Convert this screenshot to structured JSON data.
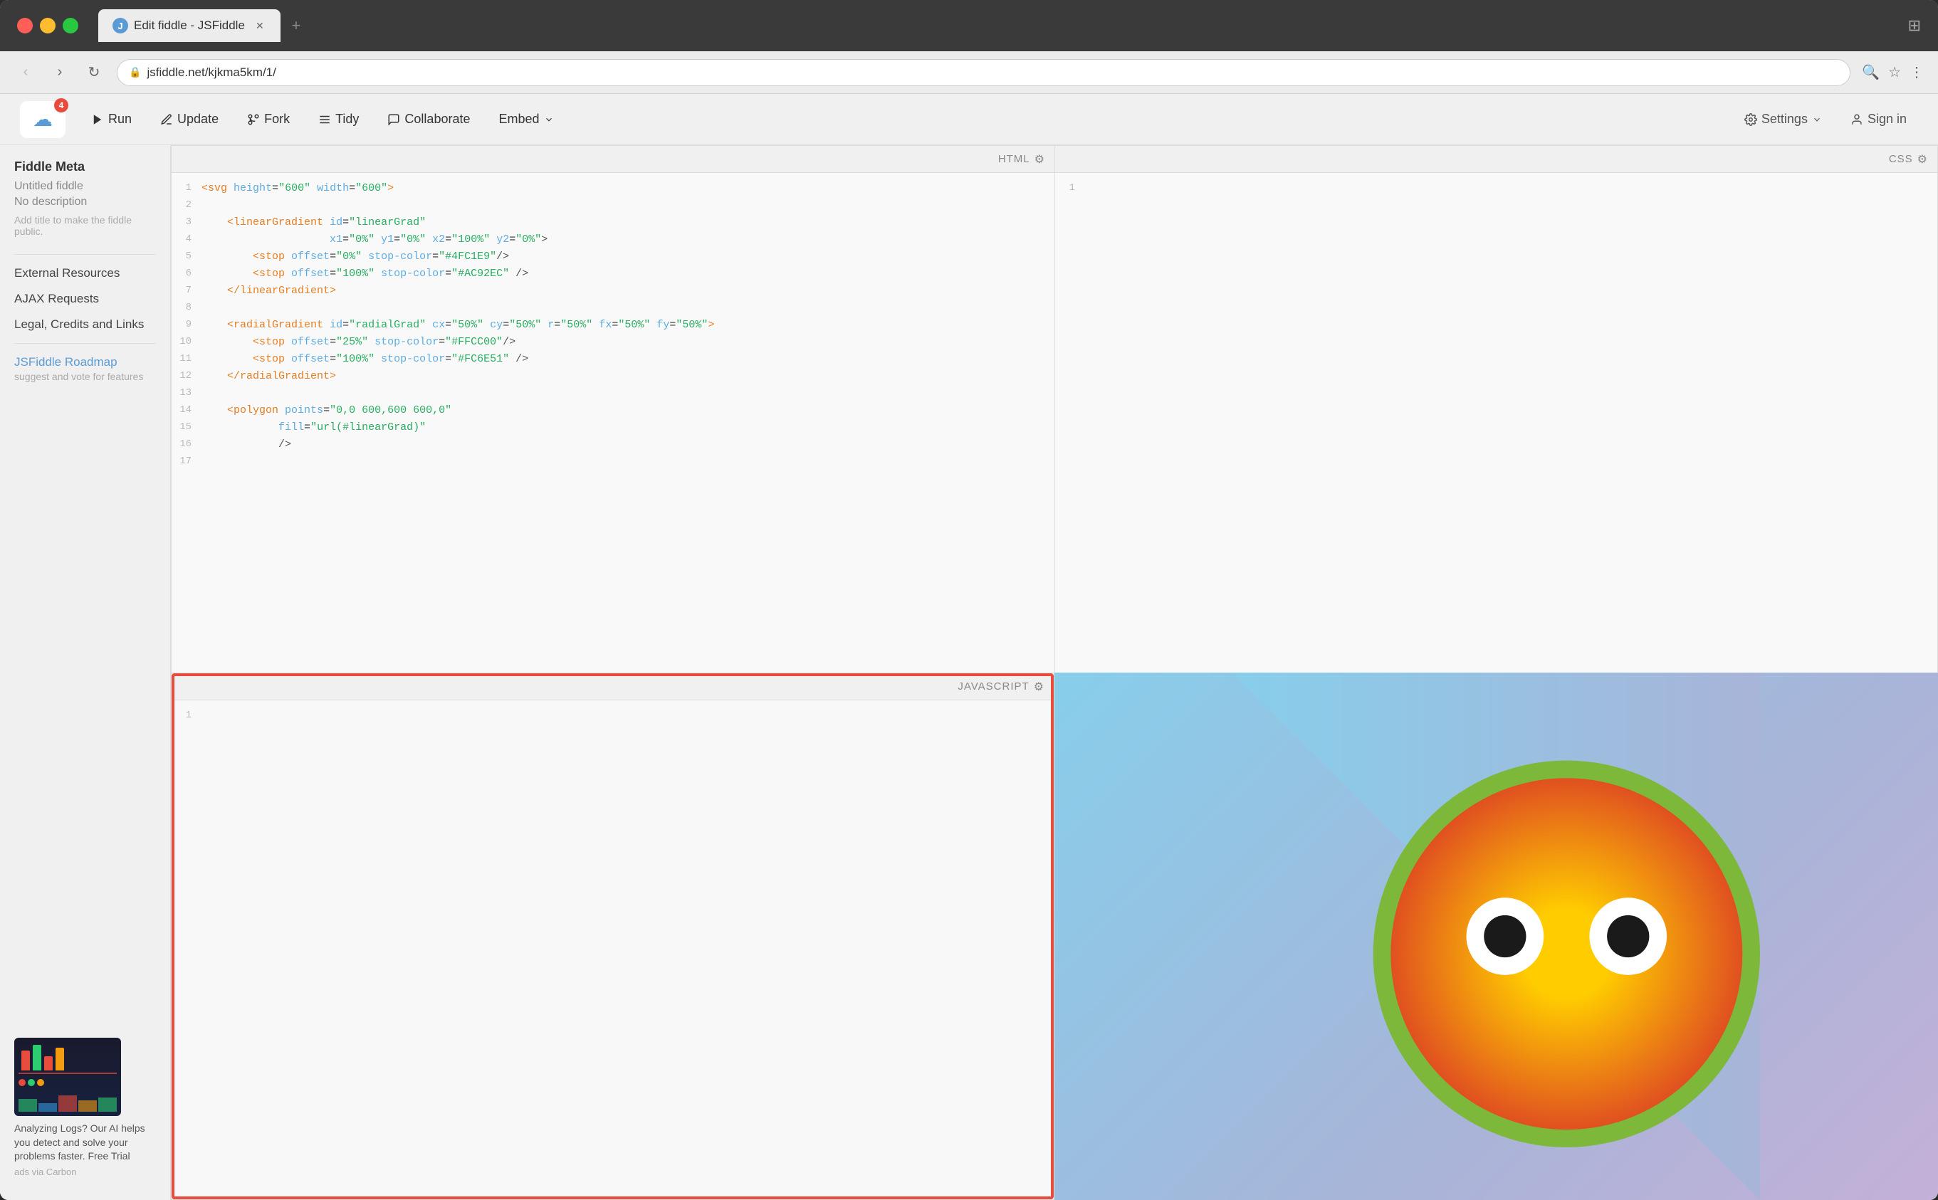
{
  "browser": {
    "traffic_lights": [
      "red",
      "yellow",
      "green"
    ],
    "tab": {
      "title": "Edit fiddle - JSFiddle",
      "favicon_letter": "J"
    },
    "address": "jsfiddle.net/kjkma5km/1/",
    "nav_back": "‹",
    "nav_forward": "›",
    "nav_reload": "↻"
  },
  "toolbar": {
    "logo_badge": "4",
    "run_label": "Run",
    "update_label": "Update",
    "fork_label": "Fork",
    "tidy_label": "Tidy",
    "collaborate_label": "Collaborate",
    "embed_label": "Embed",
    "settings_label": "Settings",
    "signin_label": "Sign in"
  },
  "sidebar": {
    "meta_title": "Fiddle Meta",
    "fiddle_name": "Untitled fiddle",
    "fiddle_desc": "No description",
    "hint": "Add title to make the fiddle public.",
    "external_resources_label": "External Resources",
    "ajax_requests_label": "AJAX Requests",
    "legal_label": "Legal, Credits and Links",
    "roadmap_title": "JSFiddle Roadmap",
    "roadmap_desc": "suggest and vote for features",
    "ad_text": "Analyzing Logs? Our AI helps you detect and solve your problems faster. Free Trial",
    "ad_source": "ads via Carbon"
  },
  "panels": {
    "html_label": "HTML",
    "css_label": "CSS",
    "js_label": "JAVASCRIPT",
    "code_lines": [
      {
        "num": 1,
        "content": "<svg height=\"600\" width=\"600\">"
      },
      {
        "num": 2,
        "content": ""
      },
      {
        "num": 3,
        "content": "    <linearGradient id=\"linearGrad\""
      },
      {
        "num": 4,
        "content": "                    x1=\"0%\" y1=\"0%\" x2=\"100%\" y2=\"0%\">"
      },
      {
        "num": 5,
        "content": "        <stop offset=\"0%\" stop-color=\"#4FC1E9\"/>"
      },
      {
        "num": 6,
        "content": "        <stop offset=\"100%\" stop-color=\"#AC92EC\" />"
      },
      {
        "num": 7,
        "content": "    </linearGradient>"
      },
      {
        "num": 8,
        "content": ""
      },
      {
        "num": 9,
        "content": "    <radialGradient id=\"radialGrad\" cx=\"50%\" cy=\"50%\" r=\"50%\" fx=\"50%\" fy=\"50%\">"
      },
      {
        "num": 10,
        "content": "        <stop offset=\"25%\" stop-color=\"#FFCC00\"/>"
      },
      {
        "num": 11,
        "content": "        <stop offset=\"100%\" stop-color=\"#FC6E51\" />"
      },
      {
        "num": 12,
        "content": "    </radialGradient>"
      },
      {
        "num": 13,
        "content": ""
      },
      {
        "num": 14,
        "content": "    <polygon points=\"0,0 600,600 600,0\""
      },
      {
        "num": 15,
        "content": "            fill=\"url(#linearGrad)\""
      },
      {
        "num": 16,
        "content": "            />"
      },
      {
        "num": 17,
        "content": ""
      }
    ],
    "js_line_num": "1"
  }
}
